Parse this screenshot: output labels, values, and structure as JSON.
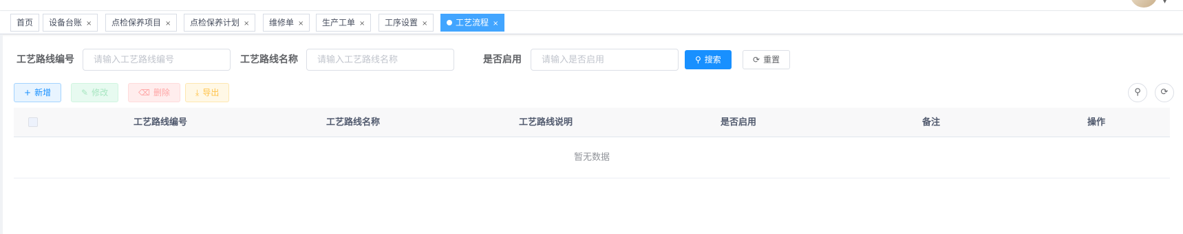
{
  "tabs": [
    {
      "label": "首页",
      "closable": false,
      "active": false
    },
    {
      "label": "设备台账",
      "closable": true,
      "active": false
    },
    {
      "label": "点检保养项目",
      "closable": true,
      "active": false
    },
    {
      "label": "点检保养计划",
      "closable": true,
      "active": false
    },
    {
      "label": "维修单",
      "closable": true,
      "active": false
    },
    {
      "label": "生产工单",
      "closable": true,
      "active": false
    },
    {
      "label": "工序设置",
      "closable": true,
      "active": false
    },
    {
      "label": "工艺流程",
      "closable": true,
      "active": true
    }
  ],
  "close_glyph": "×",
  "search": {
    "route_code_label": "工艺路线编号",
    "route_code_placeholder": "请输入工艺路线编号",
    "route_name_label": "工艺路线名称",
    "route_name_placeholder": "请输入工艺路线名称",
    "enabled_label": "是否启用",
    "enabled_placeholder": "请输入是否启用",
    "search_button": "搜索",
    "reset_button": "重置"
  },
  "toolbar": {
    "add": "新增",
    "edit": "修改",
    "delete": "删除",
    "export": "导出"
  },
  "icons": {
    "add": "plus-icon",
    "edit": "edit-icon",
    "delete": "trash-icon",
    "export": "download-icon",
    "search": "search-icon",
    "reset": "refresh-icon"
  },
  "table": {
    "columns": [
      "工艺路线编号",
      "工艺路线名称",
      "工艺路线说明",
      "是否启用",
      "备注",
      "操作"
    ],
    "empty_text": "暂无数据"
  },
  "colors": {
    "primary": "#1890ff",
    "active_tab": "#42a5ff"
  }
}
